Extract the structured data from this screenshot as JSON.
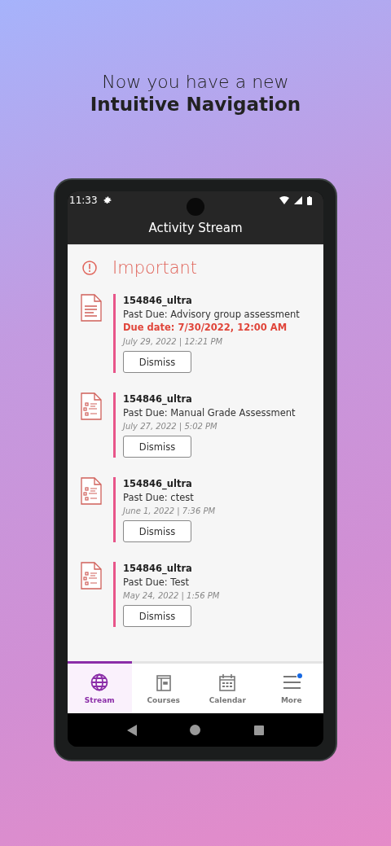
{
  "headline": {
    "line1": "Now you have a new",
    "line2": "Intuitive Navigation"
  },
  "status_bar": {
    "time": "11:33"
  },
  "app_bar": {
    "title": "Activity Stream"
  },
  "section": {
    "title": "Important"
  },
  "items": [
    {
      "kind": "document",
      "course": "154846_ultra",
      "title": "Past Due: Advisory group assessment",
      "due": "Due date: 7/30/2022, 12:00 AM",
      "date": "July 29, 2022 | 12:21 PM",
      "button": "Dismiss"
    },
    {
      "kind": "test",
      "course": "154846_ultra",
      "title": "Past Due: Manual Grade Assessment",
      "date": "July 27, 2022 | 5:02 PM",
      "button": "Dismiss"
    },
    {
      "kind": "test",
      "course": "154846_ultra",
      "title": "Past Due: ctest",
      "date": "June 1, 2022 | 7:36 PM",
      "button": "Dismiss"
    },
    {
      "kind": "test",
      "course": "154846_ultra",
      "title": "Past Due: Test",
      "date": "May 24, 2022 | 1:56 PM",
      "button": "Dismiss"
    }
  ],
  "tabs": [
    {
      "kind": "globe",
      "label": "Stream",
      "selected": true,
      "badge": false
    },
    {
      "kind": "courses",
      "label": "Courses",
      "selected": false,
      "badge": false
    },
    {
      "kind": "calendar",
      "label": "Calendar",
      "selected": false,
      "badge": false
    },
    {
      "kind": "menu",
      "label": "More",
      "selected": false,
      "badge": true
    }
  ]
}
